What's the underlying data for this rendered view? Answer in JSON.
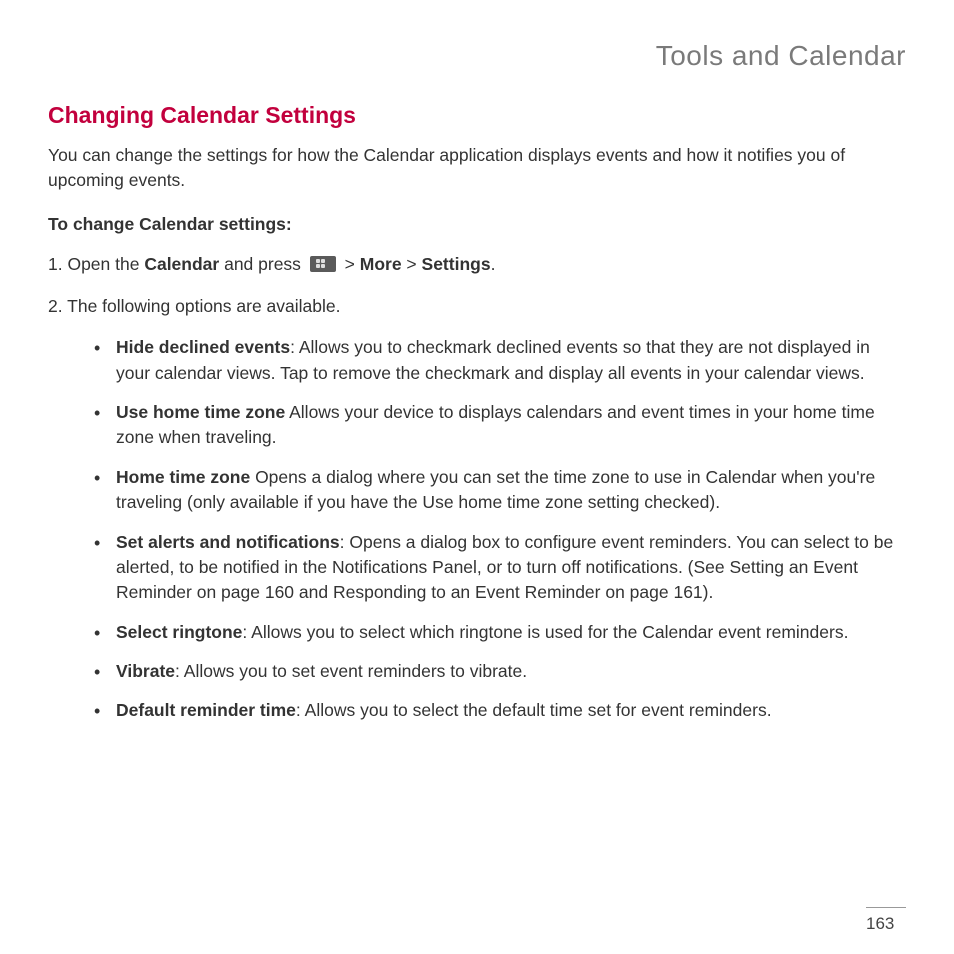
{
  "chapter": "Tools and Calendar",
  "section": "Changing Calendar Settings",
  "intro": "You can change the settings for how the Calendar application displays events and how it notifies you of upcoming events.",
  "subhead": "To change Calendar settings:",
  "step1": {
    "prefix": "1. Open the ",
    "bold1": "Calendar",
    "mid1": " and press ",
    "gt1": " > ",
    "bold2": "More",
    "gt2": " > ",
    "bold3": "Settings",
    "suffix": "."
  },
  "step2": "2. The following options are available.",
  "opts": [
    {
      "bold": "Hide declined events",
      "rest": ": Allows you to checkmark declined events so that they are not displayed in your calendar views. Tap to remove the checkmark and display all events in your calendar views."
    },
    {
      "bold": "Use home time zone",
      "rest": " Allows your device to displays calendars and event times in your home time zone when traveling."
    },
    {
      "bold": "Home time zone",
      "rest": " Opens a dialog where you can set the time zone to use in Calendar when you're traveling (only available if you have the Use home time zone setting checked)."
    },
    {
      "bold": "Set alerts and notifications",
      "rest": ": Opens a dialog box to configure event reminders. You can select to be alerted, to be notified in the Notifications Panel, or to turn off notifications. (See Setting an Event Reminder on page 160 and Responding to an Event Reminder on page 161)."
    },
    {
      "bold": "Select ringtone",
      "rest": ": Allows you to select which ringtone is used for the Calendar event reminders."
    },
    {
      "bold": "Vibrate",
      "rest": ": Allows you to set event reminders to vibrate."
    },
    {
      "bold": "Default reminder time",
      "rest": ": Allows you to select the default time set for event reminders."
    }
  ],
  "page": "163"
}
